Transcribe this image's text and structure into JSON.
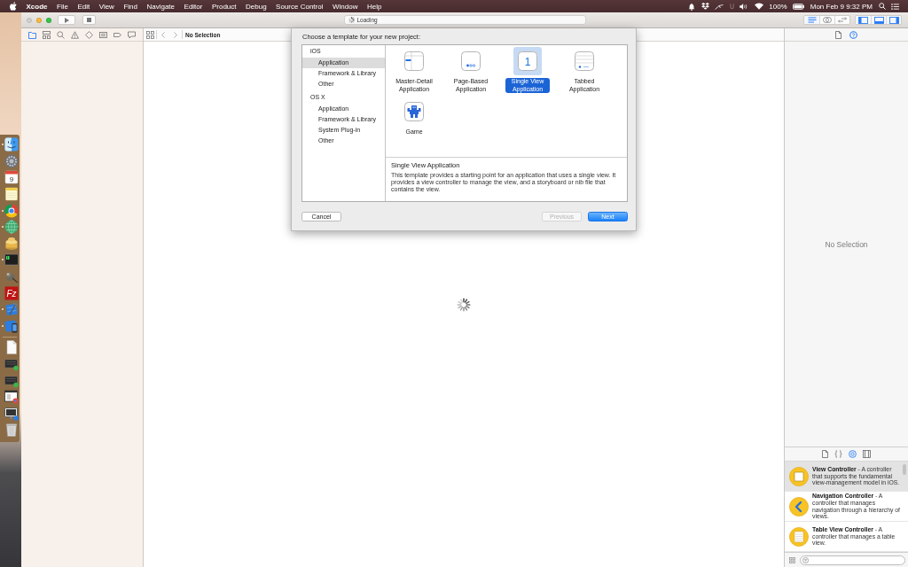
{
  "menu_bar": {
    "app": "Xcode",
    "menus": [
      "File",
      "Edit",
      "View",
      "Find",
      "Navigate",
      "Editor",
      "Product",
      "Debug",
      "Source Control",
      "Window",
      "Help"
    ],
    "battery": "100%",
    "clock": "Mon Feb 9 9:32 PM"
  },
  "dock": {
    "apps": [
      {
        "kind": "finder",
        "running": true
      },
      {
        "kind": "gear",
        "running": false
      },
      {
        "kind": "calendar",
        "label": "9",
        "running": false
      },
      {
        "kind": "notes",
        "running": false
      },
      {
        "kind": "wheel",
        "running": true
      },
      {
        "kind": "globe",
        "running": true
      },
      {
        "kind": "stack",
        "running": false
      },
      {
        "kind": "terminal",
        "running": true
      },
      {
        "kind": "brush",
        "running": false
      },
      {
        "kind": "tile",
        "label": "Fz",
        "running": false
      },
      {
        "kind": "hammer",
        "running": true
      },
      {
        "kind": "tablet",
        "running": true
      }
    ],
    "others": [
      {
        "kind": "document"
      },
      {
        "kind": "screen"
      },
      {
        "kind": "screen"
      },
      {
        "kind": "window"
      },
      {
        "kind": "monitor"
      },
      {
        "kind": "trash"
      }
    ]
  },
  "window": {
    "traffic_lights": [
      {
        "kind": "close",
        "disabled": true
      },
      {
        "kind": "minimize",
        "disabled": false
      },
      {
        "kind": "zoom",
        "disabled": false
      }
    ]
  },
  "toolbar": {
    "activity": "Loading",
    "editor_modes": [
      {
        "kind": "standard",
        "selected": true
      },
      {
        "kind": "assistant",
        "selected": false
      },
      {
        "kind": "version",
        "selected": false
      }
    ],
    "panels": [
      {
        "kind": "navigator",
        "on": true
      },
      {
        "kind": "debug",
        "on": true
      },
      {
        "kind": "utilities",
        "on": true
      }
    ]
  },
  "navigator": {
    "tabs": [
      {
        "kind": "folder",
        "selected": true
      },
      {
        "kind": "hierarchy",
        "selected": false
      },
      {
        "kind": "search",
        "selected": false
      },
      {
        "kind": "warning",
        "selected": false
      },
      {
        "kind": "diamond",
        "selected": false
      },
      {
        "kind": "bars",
        "selected": false
      },
      {
        "kind": "tag",
        "selected": false
      },
      {
        "kind": "speech",
        "selected": false
      }
    ]
  },
  "jump_bar": {
    "path": "No Selection"
  },
  "template_chooser": {
    "title": "Choose a template for your new project:",
    "categories": [
      {
        "label": "iOS",
        "children": [
          {
            "label": "Application",
            "selected": true
          },
          {
            "label": "Framework & Library",
            "selected": false
          },
          {
            "label": "Other",
            "selected": false
          }
        ]
      },
      {
        "label": "OS X",
        "children": [
          {
            "label": "Application",
            "selected": false
          },
          {
            "label": "Framework & Library",
            "selected": false
          },
          {
            "label": "System Plug-in",
            "selected": false
          },
          {
            "label": "Other",
            "selected": false
          }
        ]
      }
    ],
    "templates": [
      {
        "kind": "master-detail",
        "label": "Master-Detail Application",
        "selected": false
      },
      {
        "kind": "page-based",
        "label": "Page-Based Application",
        "selected": false
      },
      {
        "kind": "single-view",
        "glyph": "1",
        "label": "Single View Application",
        "selected": true
      },
      {
        "kind": "tabbed",
        "label": "Tabbed Application",
        "selected": false
      },
      {
        "kind": "game",
        "label": "Game",
        "selected": false
      }
    ],
    "description": {
      "title": "Single View Application",
      "text": "This template provides a starting point for an application that uses a single view. It provides a view controller to manage the view, and a storyboard or nib file that contains the view."
    },
    "buttons": [
      {
        "label": "Cancel",
        "default": false,
        "disabled": false
      },
      {
        "label": "Previous",
        "default": false,
        "disabled": true
      },
      {
        "label": "Next",
        "default": true,
        "disabled": false
      }
    ]
  },
  "inspector": {
    "tabs": [
      {
        "kind": "file",
        "selected": false
      },
      {
        "kind": "help",
        "selected": true
      }
    ],
    "empty_message": "No Selection"
  },
  "library": {
    "tabs": [
      {
        "kind": "file",
        "selected": false
      },
      {
        "kind": "braces",
        "selected": false
      },
      {
        "kind": "object",
        "selected": true
      },
      {
        "kind": "media",
        "selected": false
      }
    ],
    "items": [
      {
        "kind": "square",
        "text": "**View Controller** - A controller that supports the fundamental view-management model in iOS.",
        "selected": true
      },
      {
        "kind": "chevron",
        "text": "**Navigation Controller** - A controller that manages navigation through a hierarchy of views.",
        "selected": false
      },
      {
        "kind": "lines",
        "text": "**Table View Controller** - A controller that manages a table view.",
        "selected": false
      }
    ]
  }
}
